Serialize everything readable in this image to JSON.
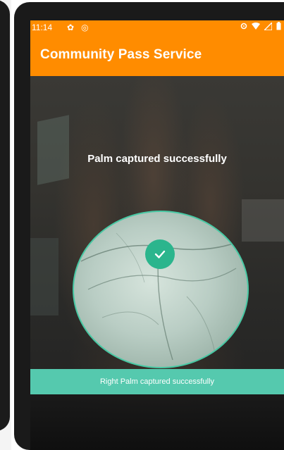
{
  "status_bar": {
    "time": "11:14",
    "icons_left": [
      "gear-icon",
      "sync-icon"
    ],
    "icons_right": [
      "vpn-key-icon",
      "wifi-icon",
      "signal-icon",
      "battery-icon"
    ]
  },
  "app_bar": {
    "title": "Community Pass Service"
  },
  "capture": {
    "headline": "Palm captured successfully",
    "banner": "Right Palm captured successfully"
  },
  "colors": {
    "brand_orange": "#ff8c00",
    "success_teal": "#55c9ae",
    "check_green": "#2bb58d"
  }
}
